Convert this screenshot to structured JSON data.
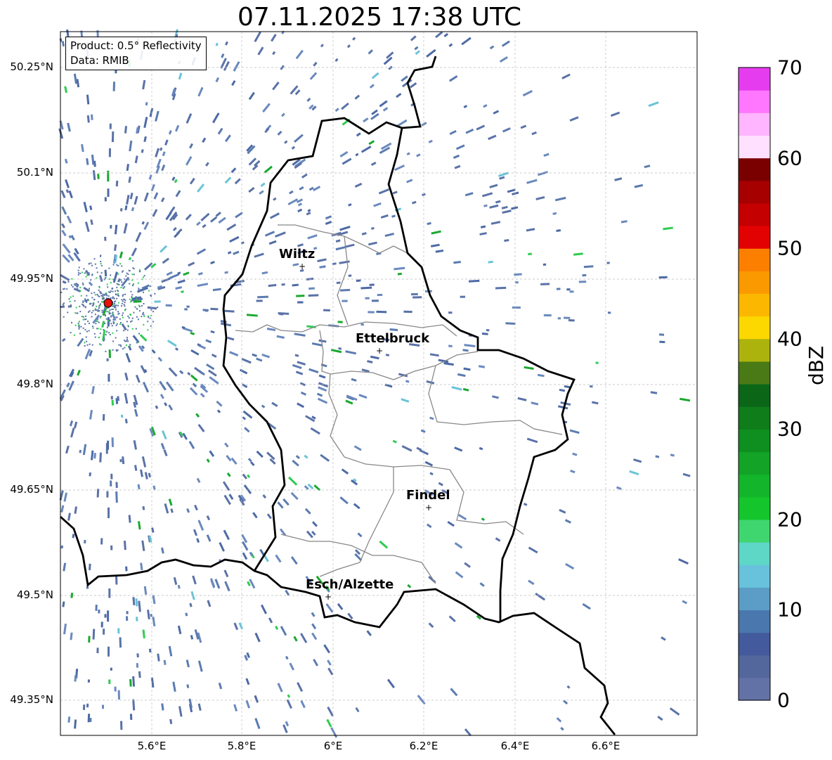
{
  "title": "07.11.2025 17:38 UTC",
  "info_box": {
    "product": "Product: 0.5° Reflectivity",
    "data_source": "Data: RMIB"
  },
  "lat_labels": [
    "50.25°N",
    "50.1°N",
    "49.95°N",
    "49.8°N",
    "49.65°N",
    "49.5°N",
    "49.35°N"
  ],
  "lon_labels": [
    "5.6°E",
    "5.8°E",
    "6°E",
    "6.2°E",
    "6.4°E",
    "6.6°E"
  ],
  "cities": [
    {
      "name": "Wiltz"
    },
    {
      "name": "Ettelbruck"
    },
    {
      "name": "Findel"
    },
    {
      "name": "Esch/Alzette"
    }
  ],
  "colorbar": {
    "label": "dBZ",
    "ticks": [
      "70",
      "60",
      "50",
      "40",
      "30",
      "20",
      "10",
      "0"
    ],
    "colors": [
      "#6372a6",
      "#53679d",
      "#435b9c",
      "#4a78ae",
      "#5b9dc6",
      "#69c2dc",
      "#5ed7c6",
      "#3fd66f",
      "#14c62b",
      "#13b62a",
      "#13a326",
      "#0f8f1f",
      "#0f7d1a",
      "#0b6618",
      "#4a7a15",
      "#adb30d",
      "#fdd700",
      "#fcb800",
      "#fb9a00",
      "#fd7f00",
      "#e30202",
      "#c50000",
      "#a60000",
      "#7a0000",
      "#ffe0ff",
      "#ffb5ff",
      "#ff77ff",
      "#e63cf0"
    ]
  },
  "radar_site": {
    "color": "#e3120b"
  }
}
